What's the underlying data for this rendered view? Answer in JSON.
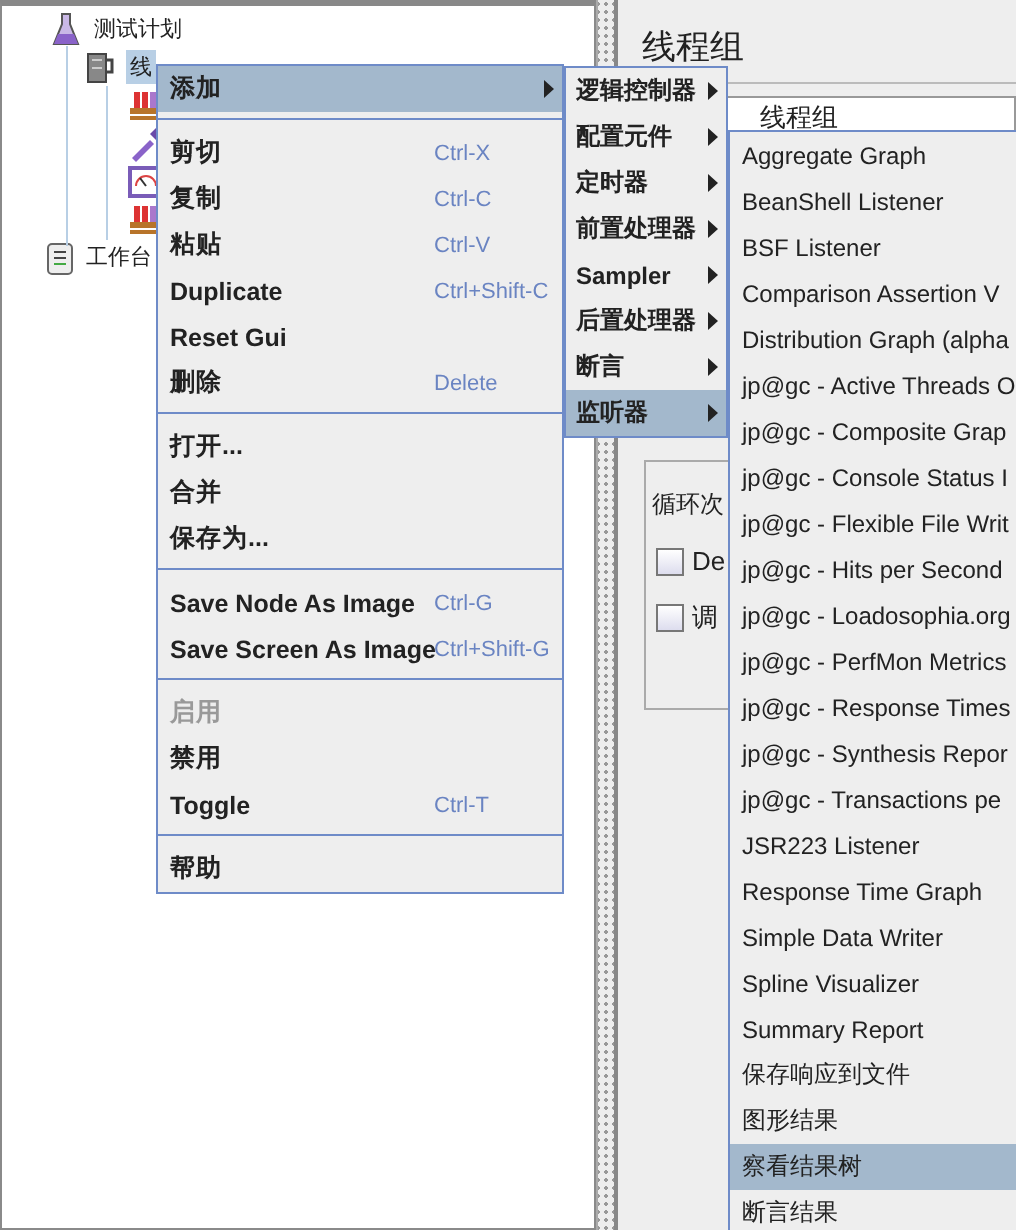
{
  "tree": {
    "items": [
      {
        "label": "测试计划",
        "selected": false,
        "children": [
          {
            "label": "线",
            "selected": true
          }
        ]
      },
      {
        "label": "工作台",
        "selected": false
      }
    ]
  },
  "panel": {
    "title": "线程组",
    "name_field": {
      "value": "线程组"
    },
    "loop_label": "循环次",
    "checkboxes": [
      {
        "label": "De",
        "checked": false
      },
      {
        "label": "调",
        "checked": false
      }
    ]
  },
  "context_menu": {
    "items": [
      {
        "kind": "item",
        "label": "添加",
        "selected": true,
        "submenu": true
      },
      {
        "kind": "separator"
      },
      {
        "kind": "item",
        "label": "剪切",
        "shortcut": "Ctrl-X",
        "selected": false
      },
      {
        "kind": "item",
        "label": "复制",
        "shortcut": "Ctrl-C",
        "selected": false
      },
      {
        "kind": "item",
        "label": "粘贴",
        "shortcut": "Ctrl-V",
        "selected": false
      },
      {
        "kind": "item",
        "label": "Duplicate",
        "shortcut": "Ctrl+Shift-C",
        "selected": false
      },
      {
        "kind": "item",
        "label": "Reset Gui",
        "selected": false
      },
      {
        "kind": "item",
        "label": "删除",
        "shortcut": "Delete",
        "selected": false
      },
      {
        "kind": "separator"
      },
      {
        "kind": "item",
        "label": "打开...",
        "selected": false
      },
      {
        "kind": "item",
        "label": "合并",
        "selected": false
      },
      {
        "kind": "item",
        "label": "保存为...",
        "selected": false
      },
      {
        "kind": "separator"
      },
      {
        "kind": "item",
        "label": "Save Node As Image",
        "shortcut": "Ctrl-G",
        "selected": false
      },
      {
        "kind": "item",
        "label": "Save Screen As Image",
        "shortcut": "Ctrl+Shift-G",
        "selected": false
      },
      {
        "kind": "separator"
      },
      {
        "kind": "item",
        "label": "启用",
        "selected": false,
        "disabled": true
      },
      {
        "kind": "item",
        "label": "禁用",
        "selected": false
      },
      {
        "kind": "item",
        "label": "Toggle",
        "shortcut": "Ctrl-T",
        "selected": false
      },
      {
        "kind": "separator"
      },
      {
        "kind": "item",
        "label": "帮助",
        "selected": false
      }
    ]
  },
  "add_submenu": {
    "items": [
      {
        "label": "逻辑控制器",
        "selected": false,
        "submenu": true
      },
      {
        "label": "配置元件",
        "selected": false,
        "submenu": true
      },
      {
        "label": "定时器",
        "selected": false,
        "submenu": true
      },
      {
        "label": "前置处理器",
        "selected": false,
        "submenu": true
      },
      {
        "label": "Sampler",
        "selected": false,
        "submenu": true
      },
      {
        "label": "后置处理器",
        "selected": false,
        "submenu": true
      },
      {
        "label": "断言",
        "selected": false,
        "submenu": true
      },
      {
        "label": "监听器",
        "selected": true,
        "submenu": true
      }
    ]
  },
  "listener_submenu": {
    "items": [
      {
        "label": "Aggregate Graph",
        "selected": false
      },
      {
        "label": "BeanShell Listener",
        "selected": false
      },
      {
        "label": "BSF Listener",
        "selected": false
      },
      {
        "label": "Comparison Assertion V",
        "selected": false
      },
      {
        "label": "Distribution Graph (alpha",
        "selected": false
      },
      {
        "label": "jp@gc - Active Threads O",
        "selected": false
      },
      {
        "label": "jp@gc - Composite Grap",
        "selected": false
      },
      {
        "label": "jp@gc - Console Status I",
        "selected": false
      },
      {
        "label": "jp@gc - Flexible File Writ",
        "selected": false
      },
      {
        "label": "jp@gc - Hits per Second",
        "selected": false
      },
      {
        "label": "jp@gc - Loadosophia.org",
        "selected": false
      },
      {
        "label": "jp@gc - PerfMon Metrics",
        "selected": false
      },
      {
        "label": "jp@gc - Response Times",
        "selected": false
      },
      {
        "label": "jp@gc - Synthesis Repor",
        "selected": false
      },
      {
        "label": "jp@gc - Transactions pe",
        "selected": false
      },
      {
        "label": "JSR223 Listener",
        "selected": false
      },
      {
        "label": "Response Time Graph",
        "selected": false
      },
      {
        "label": "Simple Data Writer",
        "selected": false
      },
      {
        "label": "Spline Visualizer",
        "selected": false
      },
      {
        "label": "Summary Report",
        "selected": false
      },
      {
        "label": "保存响应到文件",
        "selected": false
      },
      {
        "label": "图形结果",
        "selected": false
      },
      {
        "label": "察看结果树",
        "selected": true
      },
      {
        "label": "断言结果",
        "selected": false
      }
    ]
  }
}
